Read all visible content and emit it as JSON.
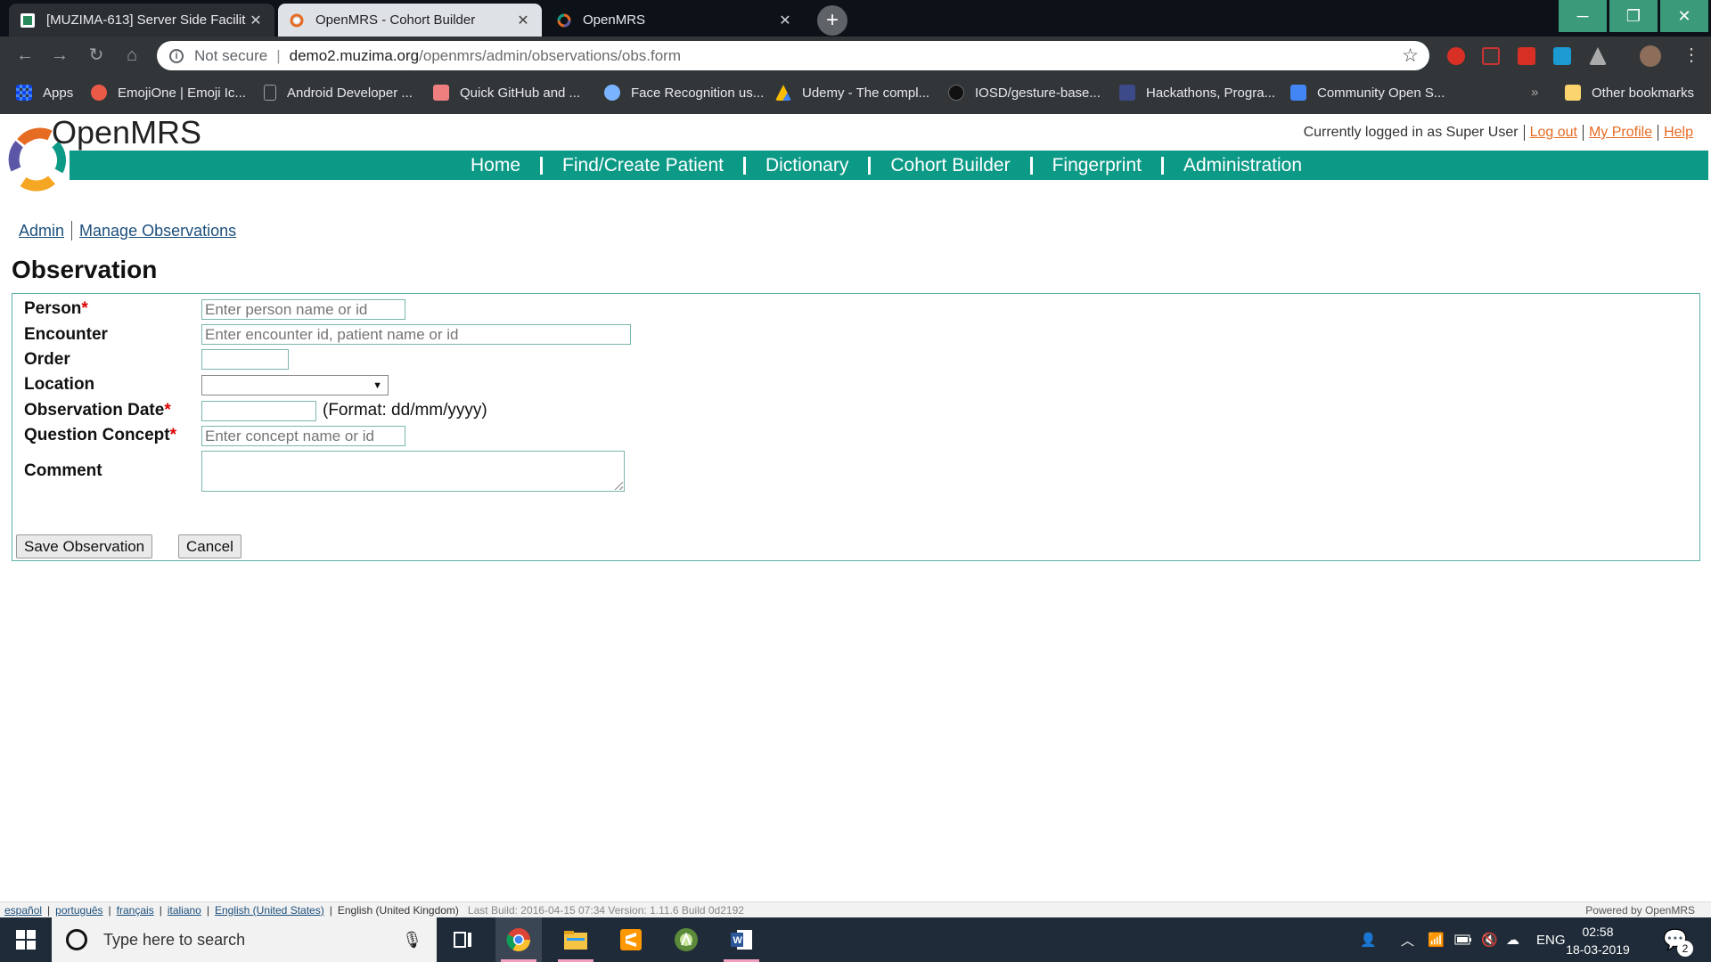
{
  "browser": {
    "tabs": [
      {
        "title": "[MUZIMA-613] Server Side Facilit",
        "close": "✕"
      },
      {
        "title": "OpenMRS - Cohort Builder",
        "close": "✕"
      },
      {
        "title": "OpenMRS",
        "close": "✕"
      }
    ],
    "new_tab": "+",
    "window_controls": {
      "minimize": "─",
      "maximize": "❐",
      "close": "✕"
    },
    "nav": {
      "back": "←",
      "forward": "→",
      "reload": "↻",
      "home": "⌂"
    },
    "omnibox": {
      "security": "Not secure",
      "host": "demo2.muzima.org",
      "path": "/openmrs/admin/observations/obs.form",
      "star": "☆"
    },
    "bookmarks": [
      {
        "label": "Apps",
        "icon": "apps-grid-icon",
        "color": "#4285f4"
      },
      {
        "label": "EmojiOne | Emoji Ic...",
        "icon": "emojione-icon",
        "color": "#ea5a47"
      },
      {
        "label": "Android Developer ...",
        "icon": "page-icon",
        "color": "#5f6368"
      },
      {
        "label": "Quick GitHub and ...",
        "icon": "github-icon",
        "color": "#ef7f7f"
      },
      {
        "label": "Face Recognition us...",
        "icon": "brain-icon",
        "color": "#7ab3ff"
      },
      {
        "label": "Udemy - The compl...",
        "icon": "drive-icon",
        "color": "#fbbc04"
      },
      {
        "label": "IOSD/gesture-base...",
        "icon": "github-cat-icon",
        "color": "#111111"
      },
      {
        "label": "Hackathons, Progra...",
        "icon": "hackathon-icon",
        "color": "#3c4a8a"
      },
      {
        "label": "Community Open S...",
        "icon": "doc-icon",
        "color": "#4285f4"
      }
    ],
    "bookmarks_more": "»",
    "other_bookmarks": "Other bookmarks"
  },
  "header": {
    "logo_text": "OpenMRS",
    "logged_in_text": "Currently logged in as Super User",
    "logout": "Log out",
    "my_profile": "My Profile",
    "help": "Help"
  },
  "navbar": [
    "Home",
    "Find/Create Patient",
    "Dictionary",
    "Cohort Builder",
    "Fingerprint",
    "Administration"
  ],
  "breadcrumb": {
    "admin": "Admin",
    "manage": "Manage Observations"
  },
  "page_title": "Observation",
  "form": {
    "person_label": "Person",
    "person_placeholder": "Enter person name or id",
    "encounter_label": "Encounter",
    "encounter_placeholder": "Enter encounter id, patient name or id",
    "order_label": "Order",
    "order_value": "",
    "location_label": "Location",
    "location_value": "",
    "obs_date_label": "Observation Date",
    "obs_date_value": "",
    "obs_date_format": "(Format: dd/mm/yyyy)",
    "question_label": "Question Concept",
    "question_placeholder": "Enter concept name or id",
    "comment_label": "Comment",
    "required_mark": "*",
    "save_button": "Save Observation",
    "cancel_button": "Cancel"
  },
  "footer": {
    "languages": [
      "español",
      "português",
      "français",
      "italiano",
      "English (United States)"
    ],
    "current_language": "English (United Kingdom)",
    "build": "Last Build: 2016-04-15 07:34   Version: 1.11.6 Build 0d2192",
    "powered": "Powered by OpenMRS"
  },
  "taskbar": {
    "search_placeholder": "Type here to search",
    "lang": "ENG",
    "time": "02:58",
    "date": "18-03-2019",
    "notifications": "2"
  },
  "colors": {
    "nav_green": "#0c9a87",
    "link_orange": "#e66b23",
    "link_blue": "#1c4f7c",
    "required_red": "#dd0000"
  }
}
